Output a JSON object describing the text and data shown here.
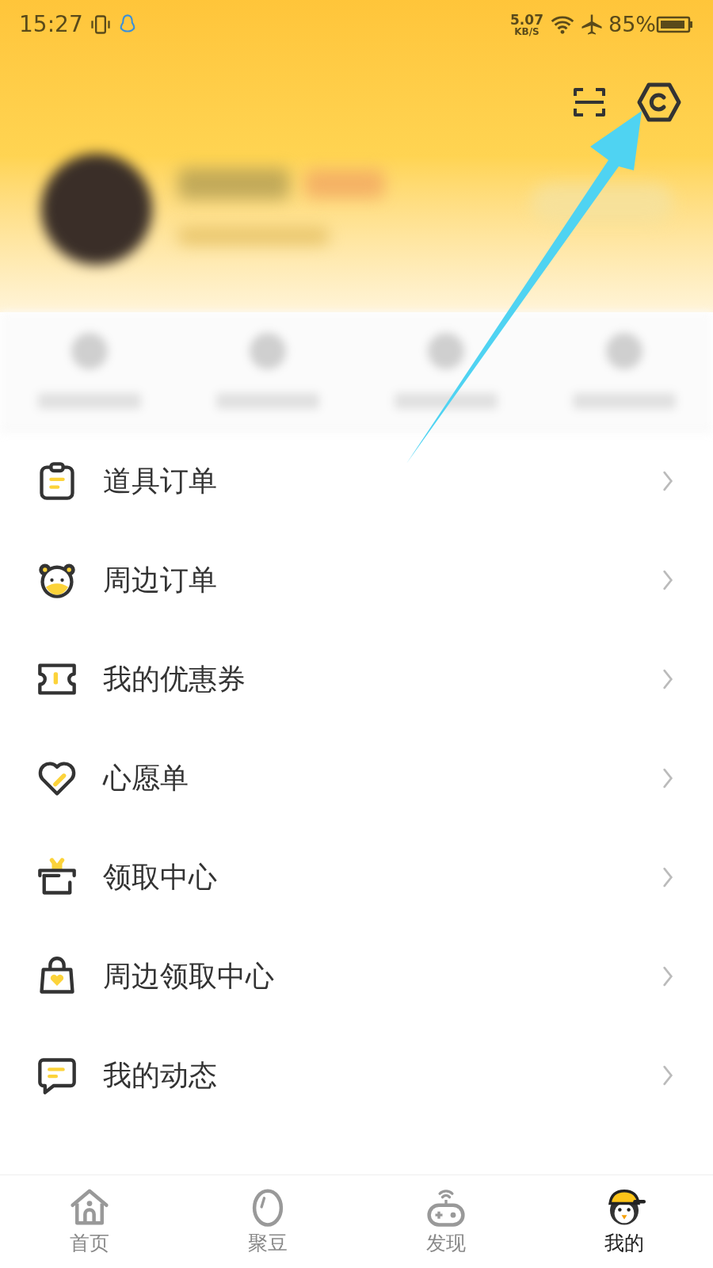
{
  "status_bar": {
    "time": "15:27",
    "speed": "5.07",
    "speed_unit": "KB/S",
    "battery": "85%"
  },
  "menu": [
    {
      "label": "道具订单"
    },
    {
      "label": "周边订单"
    },
    {
      "label": "我的优惠券"
    },
    {
      "label": "心愿单"
    },
    {
      "label": "领取中心"
    },
    {
      "label": "周边领取中心"
    },
    {
      "label": "我的动态"
    }
  ],
  "tab_bar": [
    {
      "label": "首页",
      "selected": false
    },
    {
      "label": "聚豆",
      "selected": false
    },
    {
      "label": "发现",
      "selected": false
    },
    {
      "label": "我的",
      "selected": true
    }
  ]
}
